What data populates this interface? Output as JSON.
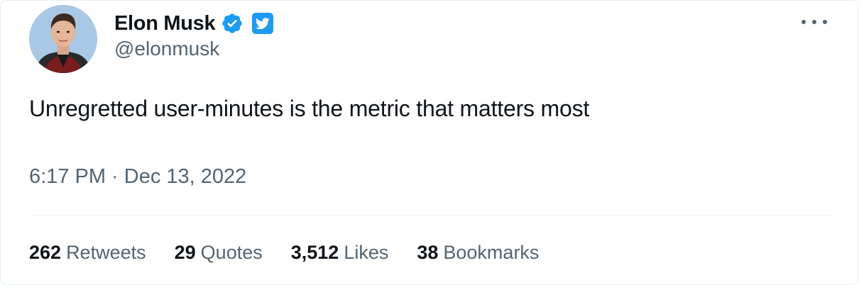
{
  "author": {
    "name": "Elon Musk",
    "handle": "@elonmusk",
    "avatar_icon": "profile-photo",
    "verified_icon": "verified-badge-icon",
    "platform_icon": "twitter-bird-icon"
  },
  "menu": {
    "more_icon": "more-options-icon"
  },
  "tweet": {
    "text": "Unregretted user-minutes is the metric that matters most",
    "timestamp": "6:17 PM · Dec 13, 2022"
  },
  "stats": {
    "retweets": {
      "value": "262",
      "label": "Retweets"
    },
    "quotes": {
      "value": "29",
      "label": "Quotes"
    },
    "likes": {
      "value": "3,512",
      "label": "Likes"
    },
    "bookmarks": {
      "value": "38",
      "label": "Bookmarks"
    }
  },
  "colors": {
    "text_primary": "#0f1419",
    "text_secondary": "#536471",
    "accent": "#1d9bf0",
    "divider": "#eff3f4"
  }
}
